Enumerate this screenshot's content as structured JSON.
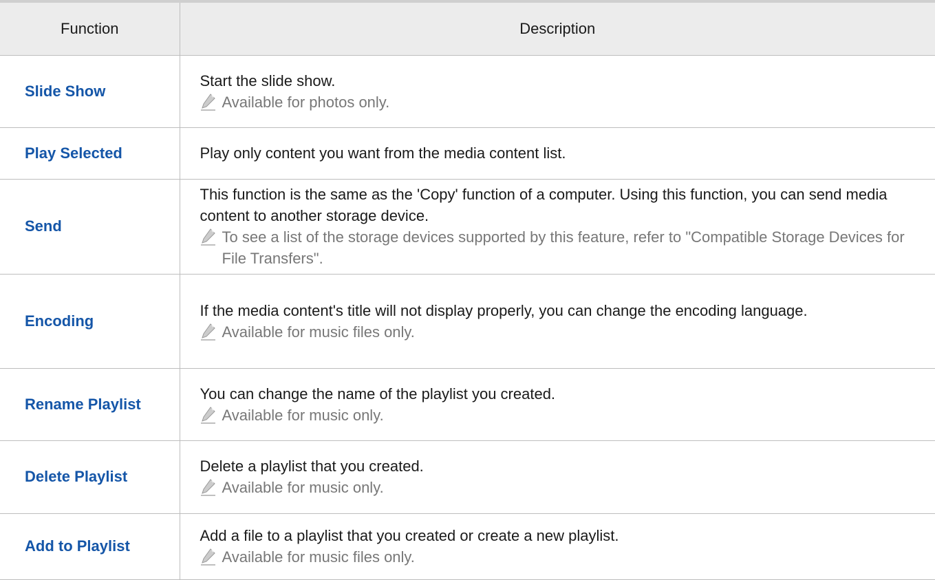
{
  "table": {
    "headers": {
      "function": "Function",
      "description": "Description"
    },
    "rows": [
      {
        "function": "Slide Show",
        "description": "Start the slide show.",
        "note": "Available for photos only."
      },
      {
        "function": "Play Selected",
        "description": "Play only content you want from the media content list.",
        "note": ""
      },
      {
        "function": "Send",
        "description": "This function is the same as the 'Copy' function of a computer. Using this function, you can send media content to another storage device.",
        "note": "To see a list of the storage devices supported by this feature, refer to \"Compatible Storage Devices for File Transfers\"."
      },
      {
        "function": "Encoding",
        "description": "If the media content's title will not display properly, you can change the encoding language.",
        "note": "Available for music files only."
      },
      {
        "function": "Rename Playlist",
        "description": "You can change the name of the playlist you created.",
        "note": "Available for music only."
      },
      {
        "function": "Delete Playlist",
        "description": "Delete a playlist that you created.",
        "note": "Available for music only."
      },
      {
        "function": "Add to Playlist",
        "description": "Add a file to a playlist that you created or create a new playlist.",
        "note": "Available for music files only."
      }
    ]
  },
  "icons": {
    "note": "pencil-note-icon"
  },
  "colors": {
    "function_text": "#1556a8",
    "note_text": "#777777",
    "header_bg": "#ececec"
  }
}
